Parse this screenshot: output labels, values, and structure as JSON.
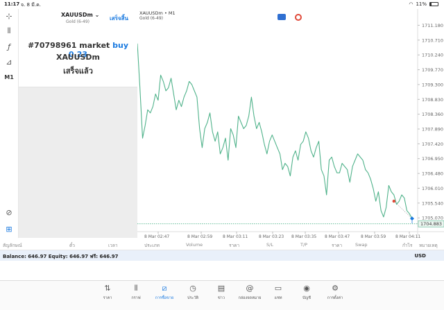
{
  "status_bar": {
    "time": "11:17",
    "date": "จ. 8 มี.ค.",
    "battery": "11%"
  },
  "order": {
    "symbol": "XAUUSDm",
    "description": "Gold (6-49)",
    "done_label": "เสร็จสิ้น",
    "line1_prefix": "#70798961 market",
    "line1_action": "buy 0.23",
    "line2": "XAUUSDm",
    "line3": "เสร็จแล้ว"
  },
  "toolbar": {
    "timeframe": "M1"
  },
  "chart_data": {
    "type": "line",
    "title": "XAUUSDm • M1",
    "subtitle": "Gold (6-49)",
    "y_ticks": [
      "1711.180",
      "1710.710",
      "1710.240",
      "1709.770",
      "1709.300",
      "1708.830",
      "1708.360",
      "1707.890",
      "1707.420",
      "1706.950",
      "1706.480",
      "1706.010",
      "1705.540",
      "1705.070"
    ],
    "ylim": [
      1704.7,
      1711.3
    ],
    "x_ticks": [
      "8 Mar 02:47",
      "8 Mar 02:59",
      "8 Mar 03:11",
      "8 Mar 03:23",
      "8 Mar 03:35",
      "8 Mar 03:47",
      "8 Mar 03:59",
      "8 Mar 04:11"
    ],
    "current_price": "1704.883",
    "series": [
      {
        "values": [
          1710.6,
          1709.2,
          1707.6,
          1708.0,
          1708.5,
          1708.4,
          1708.6,
          1709.0,
          1708.8,
          1709.6,
          1709.4,
          1709.1,
          1709.2,
          1709.5,
          1709.0,
          1708.5,
          1708.8,
          1708.6,
          1708.9,
          1709.1,
          1709.4,
          1709.3,
          1709.1,
          1708.9,
          1707.9,
          1707.3,
          1707.9,
          1708.1,
          1708.4,
          1707.8,
          1707.5,
          1707.8,
          1707.1,
          1707.3,
          1707.6,
          1706.9,
          1707.9,
          1707.7,
          1707.3,
          1708.3,
          1708.1,
          1707.9,
          1708.0,
          1708.3,
          1708.9,
          1708.3,
          1707.9,
          1708.1,
          1707.8,
          1707.4,
          1707.1,
          1707.5,
          1707.7,
          1707.5,
          1707.3,
          1707.1,
          1706.6,
          1706.8,
          1706.7,
          1706.4,
          1707.0,
          1707.2,
          1706.9,
          1707.4,
          1707.5,
          1707.8,
          1707.6,
          1707.2,
          1707.0,
          1707.3,
          1707.5,
          1706.6,
          1706.4,
          1705.8,
          1706.9,
          1707.0,
          1706.7,
          1706.5,
          1706.5,
          1706.8,
          1706.7,
          1706.6,
          1706.2,
          1706.7,
          1706.9,
          1707.1,
          1707.0,
          1706.9,
          1706.6,
          1706.5,
          1706.3,
          1706.0,
          1705.6,
          1705.9,
          1705.3,
          1705.1,
          1705.4,
          1706.1,
          1705.9,
          1705.8,
          1705.5,
          1705.6,
          1705.8,
          1705.7,
          1705.3,
          1705.2,
          1705.05
        ],
        "color": "#4fb28a"
      }
    ],
    "trade_markers": [
      {
        "type": "sell",
        "price": 1705.6,
        "color": "#e04a3a"
      },
      {
        "type": "buy",
        "price": 1705.05,
        "color": "#1a7ae0"
      }
    ]
  },
  "trade_columns": [
    "สัญลักษณ์",
    "ตั๋ว",
    "เวลา",
    "ประเภท",
    "Volume",
    "ราคา",
    "S/L",
    "T/P",
    "ราคา",
    "Swap",
    "กำไร",
    "หมายเหตุ"
  ],
  "balance": {
    "text": "Balance: 646.97 Equity: 646.97 ฟรี: 646.97",
    "currency": "USD"
  },
  "tabs": [
    {
      "icon": "quotes-icon",
      "label": "ราคา"
    },
    {
      "icon": "chart-icon",
      "label": "กราฟ"
    },
    {
      "icon": "trade-icon",
      "label": "การซื้อขาย",
      "active": true
    },
    {
      "icon": "history-icon",
      "label": "ประวัติ"
    },
    {
      "icon": "news-icon",
      "label": "ข่าว"
    },
    {
      "icon": "mailbox-icon",
      "label": "กล่องจดหมาย"
    },
    {
      "icon": "chat-icon",
      "label": "แชท"
    },
    {
      "icon": "account-icon",
      "label": "บัญชี"
    },
    {
      "icon": "settings-icon",
      "label": "การตั้งค่า"
    }
  ]
}
